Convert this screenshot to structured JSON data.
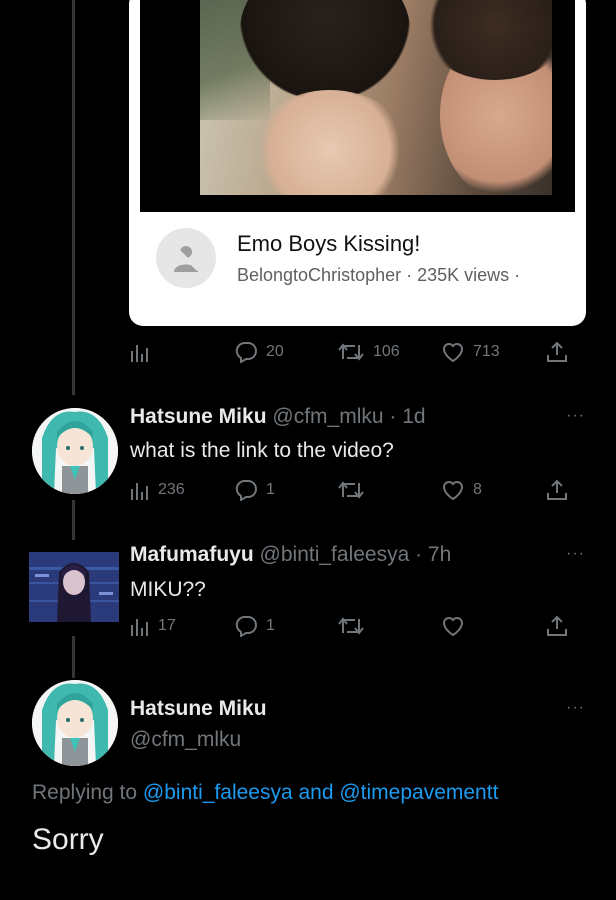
{
  "video_card": {
    "title": "Emo Boys Kissing!",
    "meta": "BelongtoChristopher · 235K views ·"
  },
  "main_actions": {
    "replies": "20",
    "retweets": "106",
    "likes": "713"
  },
  "tweets": [
    {
      "name": "Hatsune Miku",
      "handle_time": "@cfm_mlku · 1d",
      "text": "what is the link to the video?",
      "views": "236",
      "replies": "1",
      "likes": "8"
    },
    {
      "name": "Mafumafuyu",
      "handle_time": "@binti_faleesya · 7h",
      "text": "MIKU??",
      "views": "17",
      "replies": "1"
    }
  ],
  "focused_tweet": {
    "name": "Hatsune Miku",
    "handle": "@cfm_mlku",
    "replying_prefix": "Replying to",
    "reply_mentions": "@binti_faleesya and @timepavementt",
    "text": "Sorry"
  },
  "more_glyph": "···",
  "colors": {
    "background": "#000000",
    "accent": "#1d9bf0",
    "muted": "#71767b",
    "text": "#e7e9ea"
  }
}
